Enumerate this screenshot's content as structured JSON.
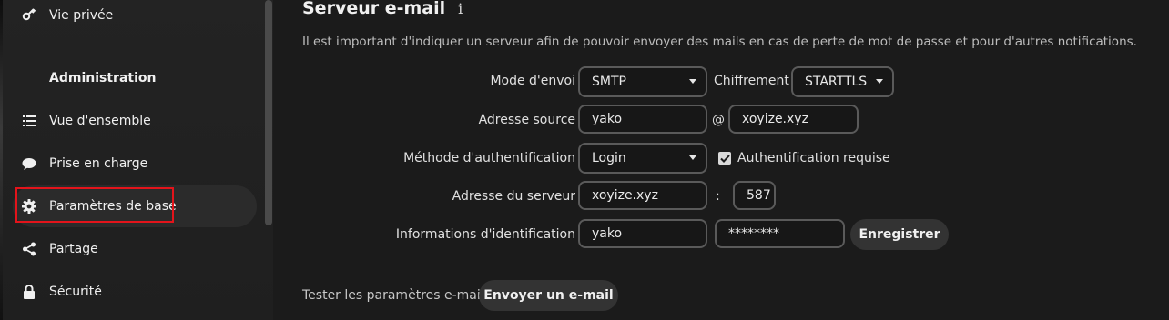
{
  "sidebar": {
    "items": [
      {
        "label": "Vie privée",
        "icon": "key-icon"
      },
      {
        "label": "Vue d'ensemble",
        "icon": "list-icon"
      },
      {
        "label": "Prise en charge",
        "icon": "chat-bubble-icon"
      },
      {
        "label": "Paramètres de base",
        "icon": "gear-icon"
      },
      {
        "label": "Partage",
        "icon": "share-icon"
      },
      {
        "label": "Sécurité",
        "icon": "lock-icon"
      }
    ],
    "section_title": "Administration"
  },
  "main": {
    "heading": "Serveur e-mail",
    "info_glyph": "i",
    "description": "Il est important d'indiquer un serveur afin de pouvoir envoyer des mails en cas de perte de mot de passe et pour d'autres notifications.",
    "form": {
      "send_mode_label": "Mode d'envoi",
      "send_mode_value": "SMTP",
      "encryption_label": "Chiffrement",
      "encryption_value": "STARTTLS",
      "source_address_label": "Adresse source",
      "source_user": "yako",
      "at_sign": "@",
      "source_domain": "xoyize.xyz",
      "auth_method_label": "Méthode d'authentification",
      "auth_method_value": "Login",
      "auth_required_label": "Authentification requise",
      "auth_required_checked": true,
      "server_address_label": "Adresse du serveur",
      "server_host": "xoyize.xyz",
      "colon": ":",
      "server_port": "587",
      "credentials_label": "Informations d'identification",
      "username": "yako",
      "password_mask": "********",
      "save_label": "Enregistrer"
    },
    "test": {
      "label": "Tester les paramètres e-mail",
      "button_label": "Envoyer un e-mail"
    }
  },
  "colors": {
    "background": "#1b1b1b",
    "highlight": "#e3141b"
  }
}
